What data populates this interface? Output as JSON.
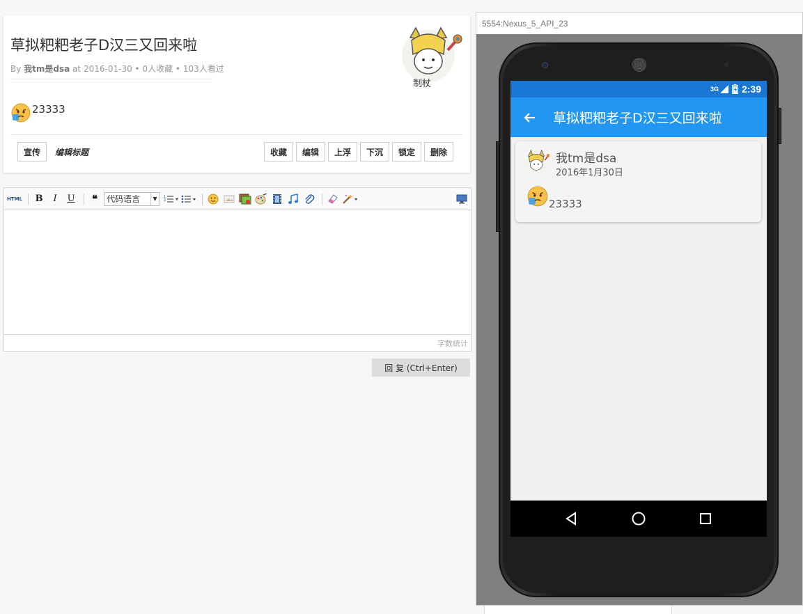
{
  "topic": {
    "title": "草拟粑粑老子D汉三又回来啦",
    "meta_by": "By",
    "author": "我tm是dsa",
    "meta_at": "at",
    "date": "2016-01-30",
    "favorites": "0人收藏",
    "views": "103人看过",
    "separator": "•",
    "body_text": "23333",
    "avatar_caption": "制杖"
  },
  "actions": {
    "left": [
      {
        "label": "宣传",
        "name": "promote-button"
      },
      {
        "label": "编辑标题",
        "name": "edit-title-link"
      }
    ],
    "right": [
      {
        "label": "收藏",
        "name": "favorite-button"
      },
      {
        "label": "编辑",
        "name": "edit-button"
      },
      {
        "label": "上浮",
        "name": "float-up-button"
      },
      {
        "label": "下沉",
        "name": "sink-button"
      },
      {
        "label": "锁定",
        "name": "lock-button"
      },
      {
        "label": "删除",
        "name": "delete-button"
      }
    ]
  },
  "editor": {
    "toolbar": {
      "html_label": "HTML",
      "bold": "B",
      "italic": "I",
      "underline": "U",
      "quote": "❝",
      "code_lang_selected": "代码语言"
    },
    "word_count_label": "字数统计",
    "content": ""
  },
  "reply_button": "回 复 (Ctrl+Enter)",
  "emulator": {
    "window_title": "5554:Nexus_5_API_23",
    "status_time": "2:39",
    "network": "3G",
    "app_title": "草拟粑粑老子D汉三又回来啦",
    "post": {
      "user": "我tm是dsa",
      "date": "2016年1月30日",
      "text": "23333"
    }
  },
  "colors": {
    "status_bar": "#1976d2",
    "app_bar": "#2196f3",
    "emulator_bg": "#808080"
  }
}
